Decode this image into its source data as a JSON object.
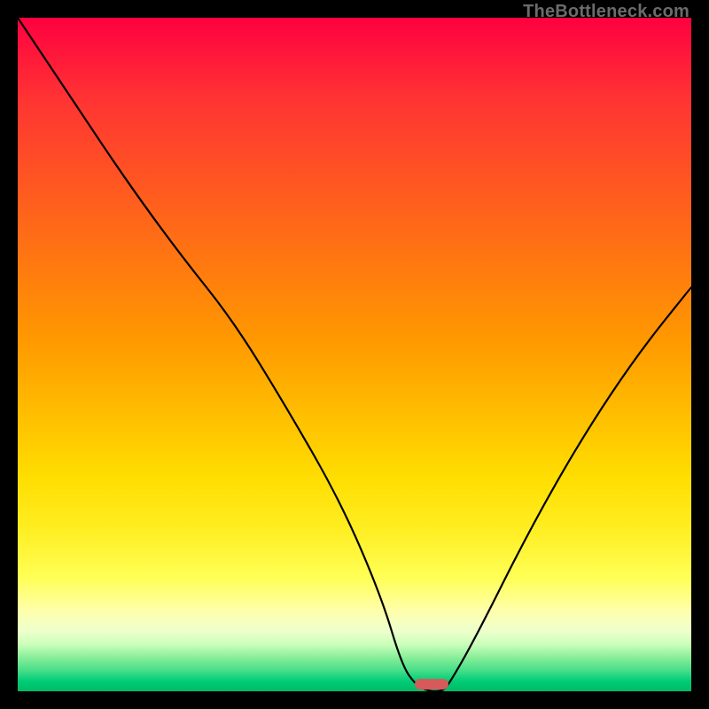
{
  "watermark": "TheBottleneck.com",
  "colors": {
    "frame": "#000000",
    "gradient_top": "#ff0040",
    "gradient_bottom": "#00bb66",
    "curve": "#000000",
    "marker": "#d65a5a"
  },
  "chart_data": {
    "type": "line",
    "title": "",
    "xlabel": "",
    "ylabel": "",
    "xlim": [
      0,
      100
    ],
    "ylim": [
      0,
      100
    ],
    "grid": false,
    "legend": false,
    "series": [
      {
        "name": "bottleneck-curve",
        "x": [
          0,
          8,
          16,
          24,
          32,
          40,
          48,
          54,
          57,
          59,
          61,
          63,
          64,
          68,
          76,
          84,
          92,
          100
        ],
        "values": [
          100,
          88,
          76,
          65,
          55,
          42,
          28,
          14,
          4,
          1,
          0,
          0,
          1,
          8,
          24,
          38,
          50,
          60
        ]
      }
    ],
    "marker": {
      "x_start": 59,
      "x_end": 64,
      "y": 0
    },
    "background": "vertical-gradient red→orange→yellow→green"
  }
}
